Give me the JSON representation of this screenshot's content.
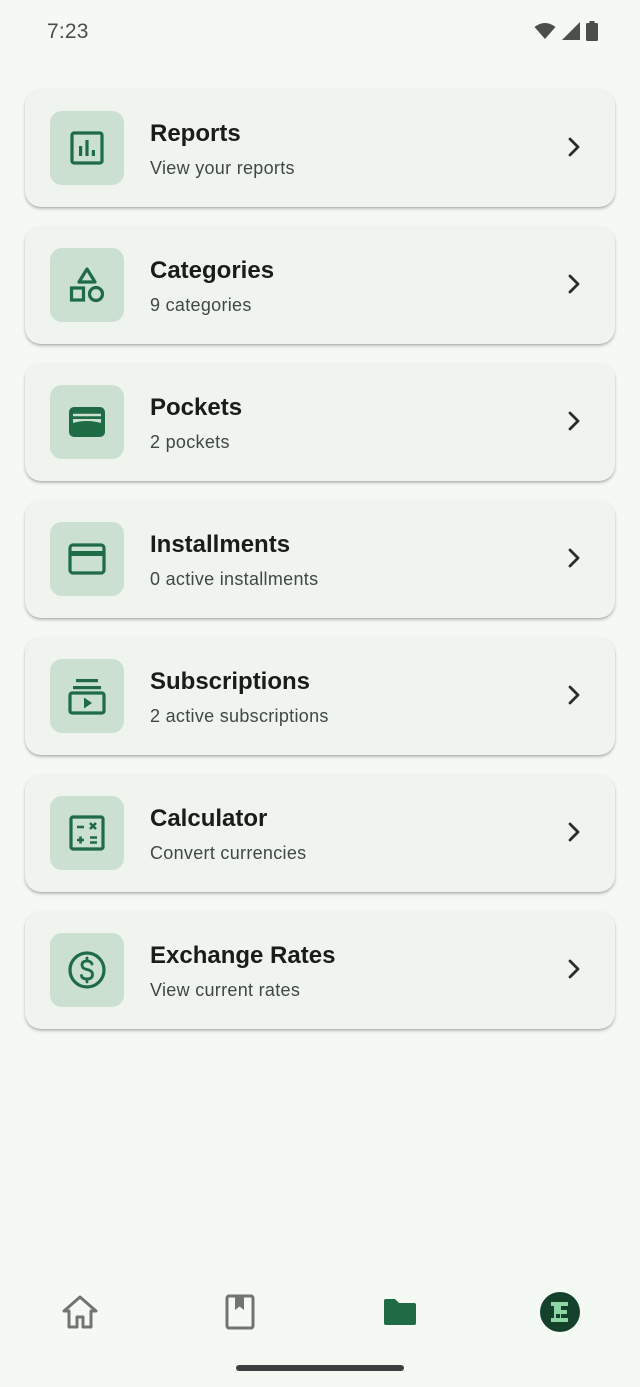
{
  "status_bar": {
    "time": "7:23",
    "icons": [
      "wifi-icon",
      "cell-signal-icon",
      "battery-icon"
    ]
  },
  "colors": {
    "background": "#f4f9f3",
    "card": "#eff4ee",
    "icon_tile": "#cbe0d1",
    "accent": "#1f6b46"
  },
  "menu": {
    "items": [
      {
        "title": "Reports",
        "subtitle": "View your reports",
        "icon": "bar-chart-icon"
      },
      {
        "title": "Categories",
        "subtitle": "9 categories",
        "icon": "shapes-icon"
      },
      {
        "title": "Pockets",
        "subtitle": "2 pockets",
        "icon": "wallet-icon"
      },
      {
        "title": "Installments",
        "subtitle": "0 active installments",
        "icon": "credit-card-icon"
      },
      {
        "title": "Subscriptions",
        "subtitle": "2 active subscriptions",
        "icon": "subscriptions-icon"
      },
      {
        "title": "Calculator",
        "subtitle": "Convert currencies",
        "icon": "calculator-icon"
      },
      {
        "title": "Exchange Rates",
        "subtitle": "View current rates",
        "icon": "dollar-circle-icon"
      }
    ]
  },
  "bottom_nav": {
    "items": [
      {
        "icon": "home-icon",
        "selected": false
      },
      {
        "icon": "bookmark-book-icon",
        "selected": false
      },
      {
        "icon": "folder-icon",
        "selected": true
      },
      {
        "icon": "app-logo-icon",
        "selected": false
      }
    ]
  }
}
